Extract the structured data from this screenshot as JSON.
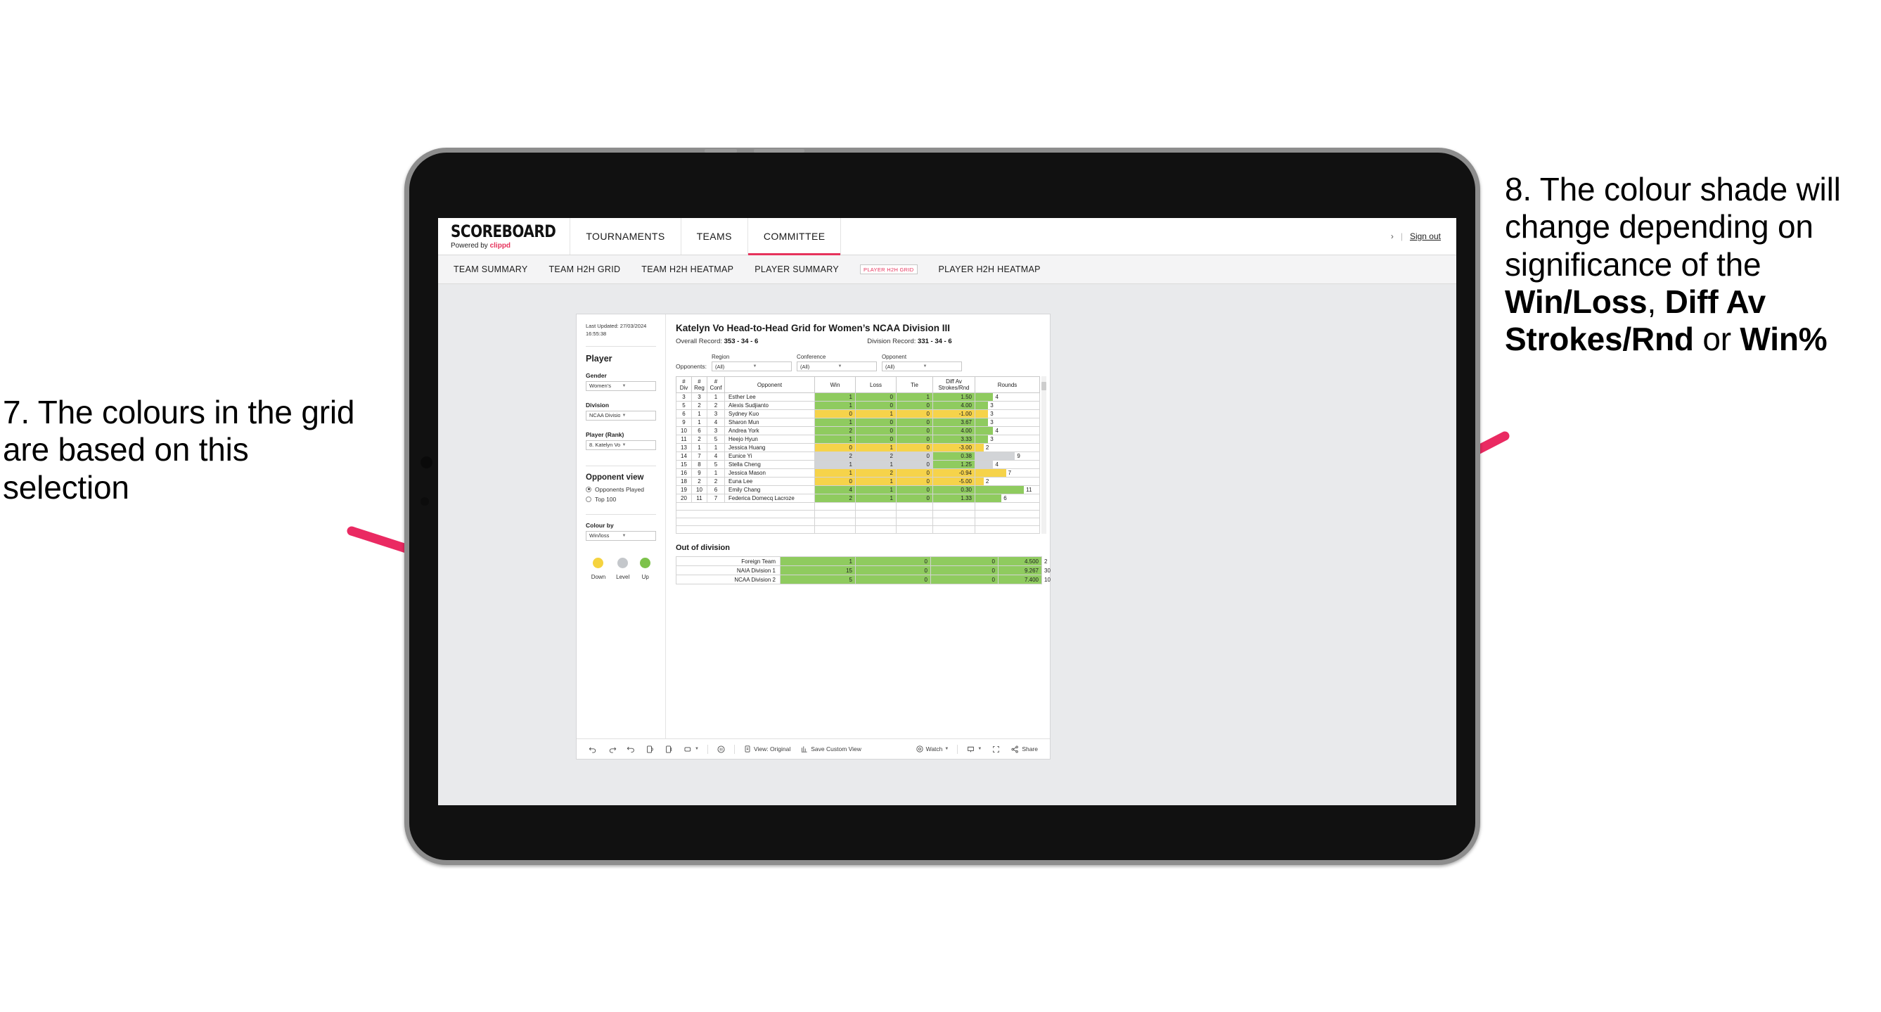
{
  "annotations": {
    "left": "7. The colours in the grid are based on this selection",
    "right_plain_1": "8. The colour shade will change depending on significance of the ",
    "right_bold_1": "Win/Loss",
    "right_plain_2": ", ",
    "right_bold_2": "Diff Av Strokes/Rnd",
    "right_plain_3": " or ",
    "right_bold_3": "Win%",
    "arrow_color": "#ea2a62"
  },
  "header": {
    "brand_title": "SCOREBOARD",
    "brand_sub_prefix": "Powered by ",
    "brand_sub_accent": "clippd",
    "nav": [
      {
        "label": "TOURNAMENTS",
        "active": false
      },
      {
        "label": "TEAMS",
        "active": false
      },
      {
        "label": "COMMITTEE",
        "active": true
      }
    ],
    "chevron": "›",
    "divider": "|",
    "sign_out": "Sign out",
    "accent": "#e6335c"
  },
  "subnav": {
    "items": [
      {
        "label": "TEAM SUMMARY",
        "selected": false
      },
      {
        "label": "TEAM H2H GRID",
        "selected": false
      },
      {
        "label": "TEAM H2H HEATMAP",
        "selected": false
      },
      {
        "label": "PLAYER SUMMARY",
        "selected": false
      },
      {
        "label": "PLAYER H2H GRID",
        "selected": true
      },
      {
        "label": "PLAYER H2H HEATMAP",
        "selected": false
      }
    ]
  },
  "panel": {
    "last_updated": "Last Updated: 27/03/2024 16:55:38",
    "player_heading": "Player",
    "gender_label": "Gender",
    "gender_value": "Women’s",
    "division_label": "Division",
    "division_value": "NCAA Division III",
    "player_rank_label": "Player (Rank)",
    "player_rank_value": "8. Katelyn Vo",
    "opponent_view_heading": "Opponent view",
    "radio_opponents_played": "Opponents Played",
    "radio_top_100": "Top 100",
    "colour_by_label": "Colour by",
    "colour_by_value": "Win/loss",
    "legend": [
      {
        "label": "Down",
        "color": "#f5d33f"
      },
      {
        "label": "Level",
        "color": "#c4c7cb"
      },
      {
        "label": "Up",
        "color": "#7dc24b"
      }
    ]
  },
  "main": {
    "title": "Katelyn Vo Head-to-Head Grid for Women’s NCAA Division III",
    "overall_record_label": "Overall Record: ",
    "overall_record_value": "353 -  34 - 6",
    "division_record_label": "Division Record: ",
    "division_record_value": "331 -  34 - 6",
    "opponents_label": "Opponents:",
    "filters": [
      {
        "label": "Region",
        "value": "(All)"
      },
      {
        "label": "Conference",
        "value": "(All)"
      },
      {
        "label": "Opponent",
        "value": "(All)"
      }
    ],
    "columns": [
      {
        "l1": "#",
        "l2": "Div"
      },
      {
        "l1": "#",
        "l2": "Reg"
      },
      {
        "l1": "#",
        "l2": "Conf"
      },
      {
        "l1": "Opponent",
        "l2": ""
      },
      {
        "l1": "Win",
        "l2": ""
      },
      {
        "l1": "Loss",
        "l2": ""
      },
      {
        "l1": "Tie",
        "l2": ""
      },
      {
        "l1": "Diff Av",
        "l2": "Strokes/Rnd"
      },
      {
        "l1": "Rounds",
        "l2": ""
      }
    ],
    "rows": [
      {
        "div": "3",
        "reg": "3",
        "conf": "1",
        "opponent": "Esther Lee",
        "win": "1",
        "loss": "0",
        "tie": "1",
        "diff": "1.50",
        "rounds": "4",
        "state": "up",
        "diff_state": "up",
        "bar_pct": 28
      },
      {
        "div": "5",
        "reg": "2",
        "conf": "2",
        "opponent": "Alexis Sudjianto",
        "win": "1",
        "loss": "0",
        "tie": "0",
        "diff": "4.00",
        "rounds": "3",
        "state": "up",
        "diff_state": "up",
        "bar_pct": 20
      },
      {
        "div": "6",
        "reg": "1",
        "conf": "3",
        "opponent": "Sydney Kuo",
        "win": "0",
        "loss": "1",
        "tie": "0",
        "diff": "-1.00",
        "rounds": "3",
        "state": "down",
        "diff_state": "down",
        "bar_pct": 20
      },
      {
        "div": "9",
        "reg": "1",
        "conf": "4",
        "opponent": "Sharon Mun",
        "win": "1",
        "loss": "0",
        "tie": "0",
        "diff": "3.67",
        "rounds": "3",
        "state": "up",
        "diff_state": "up",
        "bar_pct": 20
      },
      {
        "div": "10",
        "reg": "6",
        "conf": "3",
        "opponent": "Andrea York",
        "win": "2",
        "loss": "0",
        "tie": "0",
        "diff": "4.00",
        "rounds": "4",
        "state": "up",
        "diff_state": "up",
        "bar_pct": 28
      },
      {
        "div": "11",
        "reg": "2",
        "conf": "5",
        "opponent": "Heejo Hyun",
        "win": "1",
        "loss": "0",
        "tie": "0",
        "diff": "3.33",
        "rounds": "3",
        "state": "up",
        "diff_state": "up",
        "bar_pct": 20
      },
      {
        "div": "13",
        "reg": "1",
        "conf": "1",
        "opponent": "Jessica Huang",
        "win": "0",
        "loss": "1",
        "tie": "0",
        "diff": "-3.00",
        "rounds": "2",
        "state": "down",
        "diff_state": "down",
        "bar_pct": 13
      },
      {
        "div": "14",
        "reg": "7",
        "conf": "4",
        "opponent": "Eunice Yi",
        "win": "2",
        "loss": "2",
        "tie": "0",
        "diff": "0.38",
        "rounds": "9",
        "state": "level",
        "diff_state": "up",
        "bar_pct": 62
      },
      {
        "div": "15",
        "reg": "8",
        "conf": "5",
        "opponent": "Stella Cheng",
        "win": "1",
        "loss": "1",
        "tie": "0",
        "diff": "1.25",
        "rounds": "4",
        "state": "level",
        "diff_state": "up",
        "bar_pct": 28
      },
      {
        "div": "16",
        "reg": "9",
        "conf": "1",
        "opponent": "Jessica Mason",
        "win": "1",
        "loss": "2",
        "tie": "0",
        "diff": "-0.94",
        "rounds": "7",
        "state": "down",
        "diff_state": "down",
        "bar_pct": 48
      },
      {
        "div": "18",
        "reg": "2",
        "conf": "2",
        "opponent": "Euna Lee",
        "win": "0",
        "loss": "1",
        "tie": "0",
        "diff": "-5.00",
        "rounds": "2",
        "state": "down",
        "diff_state": "down",
        "bar_pct": 13
      },
      {
        "div": "19",
        "reg": "10",
        "conf": "6",
        "opponent": "Emily Chang",
        "win": "4",
        "loss": "1",
        "tie": "0",
        "diff": "0.30",
        "rounds": "11",
        "state": "up",
        "diff_state": "up",
        "bar_pct": 76
      },
      {
        "div": "20",
        "reg": "11",
        "conf": "7",
        "opponent": "Federica Domecq Lacroze",
        "win": "2",
        "loss": "1",
        "tie": "0",
        "diff": "1.33",
        "rounds": "6",
        "state": "up",
        "diff_state": "up",
        "bar_pct": 41
      }
    ],
    "out_of_division_heading": "Out of division",
    "out_of_division_rows": [
      {
        "label": "Foreign Team",
        "win": "1",
        "loss": "0",
        "tie": "0",
        "diff": "4.500",
        "rounds": "2",
        "state": "up",
        "bar_pct": 7
      },
      {
        "label": "NAIA Division 1",
        "win": "15",
        "loss": "0",
        "tie": "0",
        "diff": "9.267",
        "rounds": "30",
        "state": "up",
        "bar_pct": 97
      },
      {
        "label": "NCAA Division 2",
        "win": "5",
        "loss": "0",
        "tie": "0",
        "diff": "7.400",
        "rounds": "10",
        "state": "up",
        "bar_pct": 27
      }
    ]
  },
  "toolbar": {
    "undo": "undo-icon",
    "redo": "redo-icon",
    "revert": "revert-icon",
    "refresh": "refresh-icon",
    "pause": "pause-icon",
    "view_label": "View: Original",
    "save_label": "Save Custom View",
    "watch_label": "Watch",
    "share_label": "Share"
  },
  "colors": {
    "up": "#8fcb5f",
    "down": "#f6d34a",
    "level": "#d2d4d7",
    "accent": "#e6335c"
  }
}
